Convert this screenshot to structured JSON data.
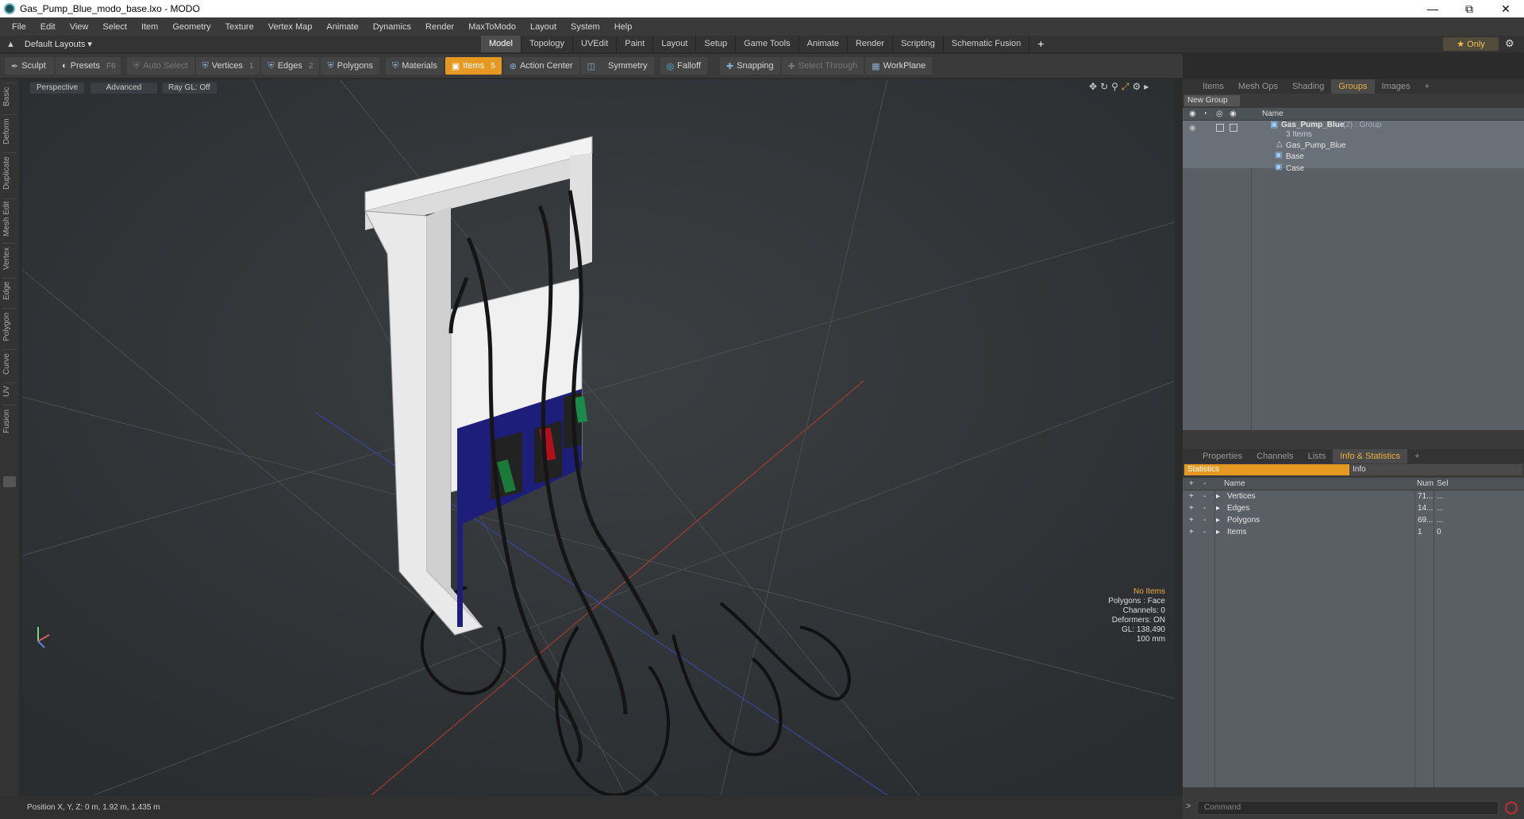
{
  "window": {
    "title": "Gas_Pump_Blue_modo_base.lxo - MODO"
  },
  "menu": [
    "File",
    "Edit",
    "View",
    "Select",
    "Item",
    "Geometry",
    "Texture",
    "Vertex Map",
    "Animate",
    "Dynamics",
    "Render",
    "MaxToModo",
    "Layout",
    "System",
    "Help"
  ],
  "layout": {
    "name": "Default Layouts",
    "tabs": [
      "Model",
      "Topology",
      "UVEdit",
      "Paint",
      "Layout",
      "Setup",
      "Game Tools",
      "Animate",
      "Render",
      "Scripting",
      "Schematic Fusion"
    ],
    "active_tab": "Model",
    "add": "+",
    "only": "Only"
  },
  "toolbar": {
    "sculpt": "Sculpt",
    "presets": "Presets",
    "presets_key": "F6",
    "auto_select": "Auto Select",
    "vertices": "Vertices",
    "vertices_key": "1",
    "edges": "Edges",
    "edges_key": "2",
    "polygons": "Polygons",
    "materials": "Materials",
    "items": "Items",
    "items_key": "5",
    "action_center": "Action Center",
    "symmetry": "Symmetry",
    "falloff": "Falloff",
    "snapping": "Snapping",
    "select_through": "Select Through",
    "workplane": "WorkPlane"
  },
  "left_tabs": [
    "Basic",
    "Deform",
    "Duplicate",
    "Mesh Edit",
    "Vertex",
    "Edge",
    "Polygon",
    "Curve",
    "UV",
    "Fusion"
  ],
  "viewport": {
    "perspective": "Perspective",
    "advanced": "Advanced",
    "raygl": "Ray GL: Off",
    "info": {
      "no_items": "No Items",
      "polygons": "Polygons : Face",
      "channels": "Channels: 0",
      "deformers": "Deformers: ON",
      "gl": "GL: 138,490",
      "scale": "100 mm"
    }
  },
  "status": {
    "position": "Position X, Y, Z:  0 m, 1.92 m, 1.435 m"
  },
  "groups_panel": {
    "tabs": [
      "Items",
      "Mesh Ops",
      "Shading",
      "Groups",
      "Images"
    ],
    "active_tab": "Groups",
    "new_group": "New Group",
    "name_header": "Name",
    "group_name": "Gas_Pump_Blue",
    "group_suffix": "(2) : Group",
    "group_count": "3 Items",
    "children": [
      "Gas_Pump_Blue",
      "Base",
      "Case"
    ]
  },
  "stats_panel": {
    "tabs": [
      "Properties",
      "Channels",
      "Lists",
      "Info & Statistics"
    ],
    "active_tab": "Info & Statistics",
    "sub_tabs": [
      "Statistics",
      "Info"
    ],
    "headers": {
      "name": "Name",
      "num": "Num",
      "sel": "Sel"
    },
    "rows": [
      {
        "name": "Vertices",
        "num": "71...",
        "sel": "..."
      },
      {
        "name": "Edges",
        "num": "14...",
        "sel": "..."
      },
      {
        "name": "Polygons",
        "num": "69...",
        "sel": "..."
      },
      {
        "name": "Items",
        "num": "1",
        "sel": "0"
      }
    ]
  },
  "command": {
    "placeholder": "Command",
    "prompt": ">"
  }
}
